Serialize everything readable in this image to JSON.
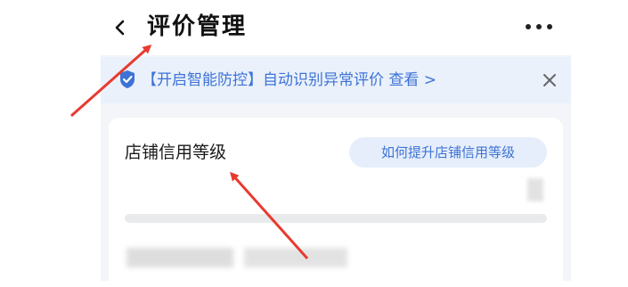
{
  "header": {
    "title": "评价管理",
    "back_icon": "chevron-left-icon",
    "more_icon": "more-dots-icon"
  },
  "banner": {
    "text": "【开启智能防控】自动识别异常评价 查看 >",
    "shield_icon": "shield-check-icon",
    "close_icon": "close-icon",
    "accent_color": "#3d73d6"
  },
  "card": {
    "title": "店铺信用等级",
    "tip_button_label": "如何提升店铺信用等级",
    "progress_value": 0
  },
  "annotations": {
    "arrow_color": "#e83a2f"
  }
}
